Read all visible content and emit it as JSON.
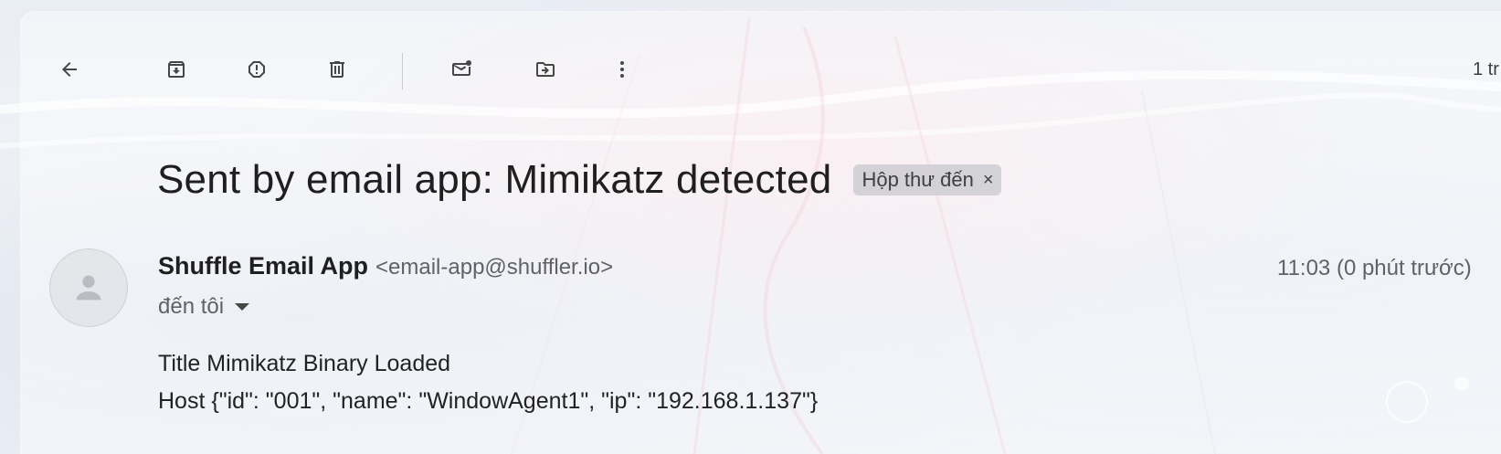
{
  "toolbar": {
    "back": {
      "icon": "arrow-back-icon",
      "tooltip": ""
    },
    "archive": {
      "icon": "archive-icon"
    },
    "report_spam": {
      "icon": "report-spam-icon"
    },
    "delete": {
      "icon": "trash-icon"
    },
    "mark_unread": {
      "icon": "mark-unread-icon"
    },
    "move_to": {
      "icon": "move-to-icon"
    },
    "more": {
      "icon": "more-vert-icon"
    },
    "pager_text": "1 tr"
  },
  "message": {
    "subject": "Sent by email app: Mimikatz detected",
    "label": "Hộp thư đến",
    "label_close": "×",
    "sender_name": "Shuffle Email App",
    "sender_email": "<email-app@shuffler.io>",
    "time": "11:03 (0 phút trước)",
    "recipient": "đến tôi",
    "body_lines": [
      "Title Mimikatz Binary Loaded",
      "Host {\"id\": \"001\", \"name\": \"WindowAgent1\", \"ip\": \"192.168.1.137\"}"
    ]
  },
  "colors": {
    "text_primary": "#1f1f1f",
    "text_secondary": "#5f6368",
    "icon": "#444746",
    "chip_bg": "#c8c8cd"
  }
}
